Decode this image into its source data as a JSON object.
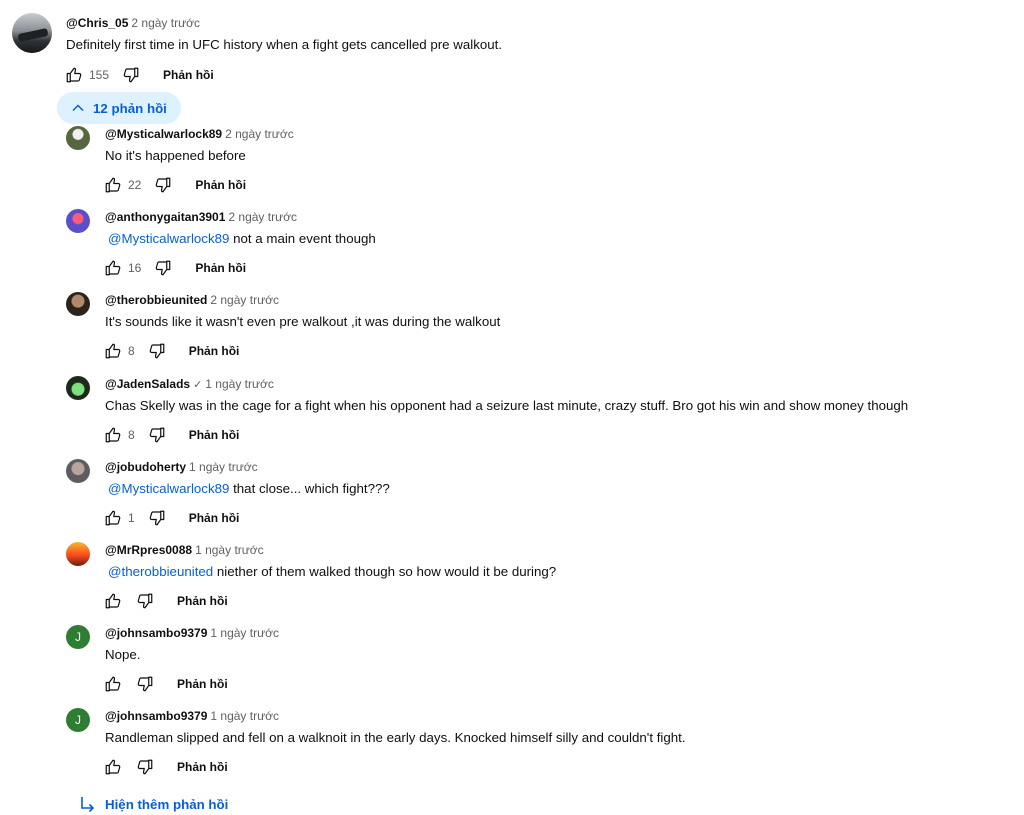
{
  "top_comment": {
    "handle": "@Chris_05",
    "time": "2 ngày trước",
    "text": "Definitely first time in UFC history when a fight gets cancelled pre walkout.",
    "likes": "155",
    "reply_label": "Phản hồi"
  },
  "replies_toggle": {
    "label": "12 phản hồi"
  },
  "replies": [
    {
      "handle": "@Mysticalwarlock89",
      "time": "2 ngày trước",
      "mention": "",
      "text": "No it's happened before",
      "likes": "22",
      "reply_label": "Phản hồi",
      "avatar_color": "#4a5a3c"
    },
    {
      "handle": "@anthonygaitan3901",
      "time": "2 ngày trước",
      "mention": "@Mysticalwarlock89",
      "text": "not a main event though",
      "likes": "16",
      "reply_label": "Phản hồi",
      "avatar_color": "#5a4fc8"
    },
    {
      "handle": "@therobbieunited",
      "time": "2 ngày trước",
      "mention": "",
      "text": "It's sounds like it wasn't even pre walkout ,it was during the walkout",
      "likes": "8",
      "reply_label": "Phản hồi",
      "avatar_color": "#3c3228"
    },
    {
      "handle": "@JadenSalads",
      "verified": "✓",
      "time": "1 ngày trước",
      "mention": "",
      "text": "Chas Skelly was in the cage for a fight when his opponent had a seizure last minute, crazy stuff. Bro got his win and show money though",
      "likes": "8",
      "reply_label": "Phản hồi",
      "avatar_color": "#1e7a3a"
    },
    {
      "handle": "@jobudoherty",
      "time": "1 ngày trước",
      "mention": "@Mysticalwarlock89",
      "text": "that close... which fight???",
      "likes": "1",
      "reply_label": "Phản hồi",
      "avatar_color": "#6e6c70"
    },
    {
      "handle": "@MrRpres0088",
      "time": "1 ngày trước",
      "mention": "@therobbieunited",
      "text": "niether of them walked though so how would it be during?",
      "likes": "",
      "reply_label": "Phản hồi",
      "avatar_color": "#e0561f"
    },
    {
      "handle": "@johnsambo9379",
      "time": "1 ngày trước",
      "mention": "",
      "text": "Nope.",
      "likes": "",
      "reply_label": "Phản hồi",
      "avatar_color": "#2e7d32",
      "avatar_letter": "J"
    },
    {
      "handle": "@johnsambo9379",
      "time": "1 ngày trước",
      "mention": "",
      "text": "Randleman slipped and fell on a walknoit in the early days. Knocked himself silly and couldn't fight.",
      "likes": "",
      "reply_label": "Phản hồi",
      "avatar_color": "#2e7d32",
      "avatar_letter": "J"
    }
  ],
  "more_replies": {
    "label": "Hiện thêm phản hồi"
  },
  "icons": {
    "like": "thumbs-up-icon",
    "dislike": "thumbs-down-icon",
    "toggle": "chevron-up-icon",
    "more": "reply-arrow-icon"
  },
  "colors": {
    "accent": "#065fd4",
    "toggle_bg": "#def1ff",
    "muted": "#606060"
  }
}
